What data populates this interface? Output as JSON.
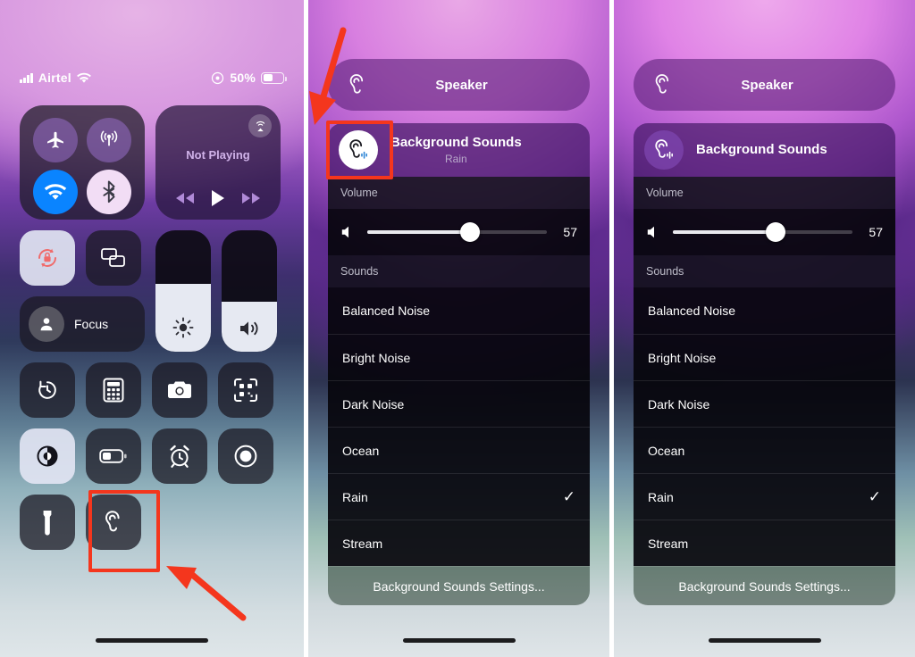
{
  "status_bar": {
    "carrier": "Airtel",
    "signal_icon": "cellular-bars-icon",
    "wifi_icon": "wifi-icon",
    "focus_icon": "focus-indicator-icon",
    "battery_percent": "50%",
    "battery_icon": "battery-icon"
  },
  "control_center": {
    "connectivity": {
      "airplane_icon": "airplane-mode-icon",
      "cellular_icon": "cellular-data-icon",
      "wifi_icon": "wifi-icon",
      "bluetooth_icon": "bluetooth-icon"
    },
    "media": {
      "title": "Not Playing",
      "airplay_icon": "airplay-icon",
      "rewind_icon": "rewind-icon",
      "play_icon": "play-icon",
      "forward_icon": "fast-forward-icon"
    },
    "tiles": {
      "rotation_lock_icon": "rotation-lock-icon",
      "screen_mirroring_icon": "screen-mirroring-icon",
      "focus_label": "Focus",
      "focus_icon": "focus-person-icon",
      "brightness_icon": "brightness-icon",
      "volume_icon": "volume-icon",
      "screen_record_timer_icon": "timer-icon",
      "calculator_icon": "calculator-icon",
      "camera_icon": "camera-icon",
      "qr_scanner_icon": "qr-code-scanner-icon",
      "dark_mode_icon": "dark-mode-icon",
      "low_power_icon": "low-power-mode-icon",
      "alarm_icon": "alarm-clock-icon",
      "screen_recording_icon": "screen-recording-icon",
      "flashlight_icon": "flashlight-icon",
      "hearing_icon": "hearing-ear-icon"
    },
    "brightness_level": 55,
    "volume_level": 40
  },
  "hearing_sheet": {
    "speaker_label": "Speaker",
    "speaker_icon": "hearing-ear-icon",
    "background_sounds_title": "Background Sounds",
    "background_sounds_subtitle": "Rain",
    "background_sounds_icon": "background-sounds-ear-icon",
    "volume_section_label": "Volume",
    "volume_mute_icon": "speaker-wave-icon",
    "volume_value": "57",
    "volume_percent": 57,
    "sounds_section_label": "Sounds",
    "sounds": [
      {
        "label": "Balanced Noise",
        "selected": false
      },
      {
        "label": "Bright Noise",
        "selected": false
      },
      {
        "label": "Dark Noise",
        "selected": false
      },
      {
        "label": "Ocean",
        "selected": false
      },
      {
        "label": "Rain",
        "selected": true
      },
      {
        "label": "Stream",
        "selected": false
      }
    ],
    "check_glyph": "✓",
    "settings_label": "Background Sounds Settings..."
  },
  "annotations": {
    "highlight_color": "#f4361d",
    "arrow_panel1": "arrow-pointing-to-hearing-tile",
    "arrow_panel2": "arrow-pointing-to-background-sounds-icon",
    "highlight_panel1": "highlight-hearing-tile",
    "highlight_panel2": "highlight-background-sounds-icon"
  }
}
